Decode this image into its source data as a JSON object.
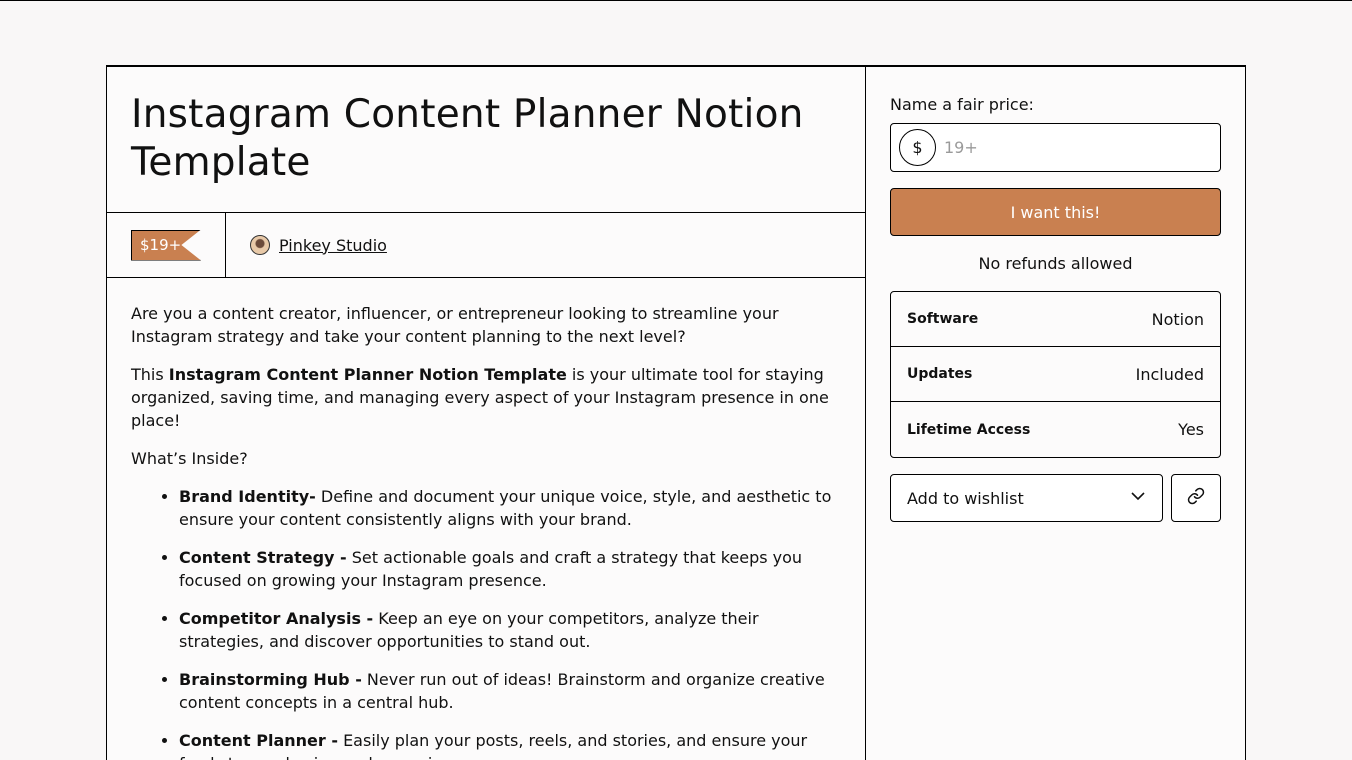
{
  "product": {
    "title": "Instagram Content Planner Notion Template",
    "price_badge": "$19+",
    "creator_name": "Pinkey Studio"
  },
  "description": {
    "intro": "Are you a content creator, influencer, or entrepreneur looking to streamline your Instagram strategy and take your content planning to the next level?",
    "this_prefix": "This ",
    "this_bold": "Instagram Content Planner Notion Template",
    "this_suffix": " is your ultimate tool for staying organized, saving time, and managing every aspect of your Instagram presence in one place!",
    "whats_inside": "What’s Inside?",
    "features": [
      {
        "name": "Brand Identity-",
        "text": " Define and document your unique voice, style, and aesthetic to ensure your content consistently aligns with your brand."
      },
      {
        "name": "Content Strategy -",
        "text": " Set actionable goals and craft a strategy that keeps you focused on growing your Instagram presence."
      },
      {
        "name": "Competitor Analysis -",
        "text": " Keep an eye on your competitors, analyze their strategies, and discover opportunities to stand out."
      },
      {
        "name": "Brainstorming Hub -",
        "text": " Never run out of ideas! Brainstorm and organize creative content concepts in a central hub."
      },
      {
        "name": "Content Planner -",
        "text": " Easily plan your posts, reels, and stories, and ensure your feed stays cohesive and engaging."
      }
    ]
  },
  "purchase": {
    "fair_price_label": "Name a fair price:",
    "currency_symbol": "$",
    "price_placeholder": "19+",
    "buy_label": "I want this!",
    "refund_note": "No refunds allowed"
  },
  "attributes": [
    {
      "key": "Software",
      "value": "Notion"
    },
    {
      "key": "Updates",
      "value": "Included"
    },
    {
      "key": "Lifetime Access",
      "value": "Yes"
    }
  ],
  "actions": {
    "wishlist_label": "Add to wishlist",
    "wishlist_icon": "chevron-down-icon",
    "share_icon": "link-icon"
  },
  "colors": {
    "accent": "#c98050",
    "background": "#f9f7f7",
    "border": "#000000"
  }
}
